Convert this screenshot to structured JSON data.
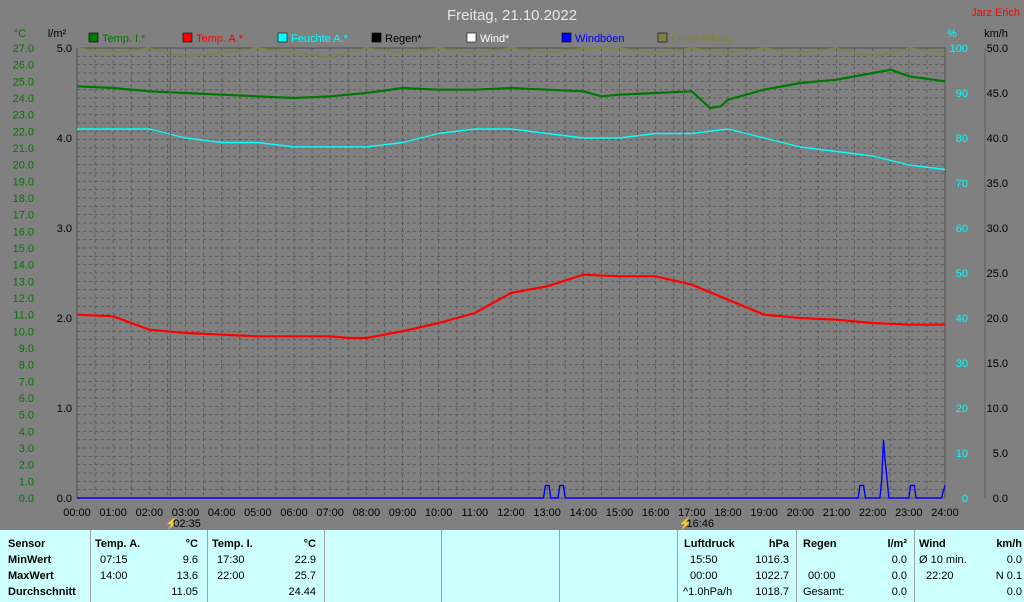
{
  "header": {
    "title": "Freitag, 21.10.2022",
    "author": "Jarz Erich"
  },
  "axis_units": {
    "left_temp": "°C",
    "left_rain": "l/m²",
    "right_humidity": "%",
    "right_wind": "km/h"
  },
  "legend": [
    {
      "label": "Temp. I.*",
      "color": "#007700"
    },
    {
      "label": "Temp. A.*",
      "color": "#ff0000"
    },
    {
      "label": "Feuchte A.*",
      "color": "#00ffff"
    },
    {
      "label": "Regen*",
      "color": "#000000"
    },
    {
      "label": "Wind*",
      "color": "#ffffff"
    },
    {
      "label": "Windböen",
      "color": "#0000ff"
    },
    {
      "label": "Einstrahlung",
      "color": "#808040"
    }
  ],
  "events": [
    {
      "time": "02:35",
      "hour": 2.58
    },
    {
      "time": "16:46",
      "hour": 16.77
    }
  ],
  "chart_data": {
    "type": "line",
    "title": "Freitag, 21.10.2022",
    "xlim": [
      0,
      24
    ],
    "x_ticks": [
      "00:00",
      "01:00",
      "02:00",
      "03:00",
      "04:00",
      "05:00",
      "06:00",
      "07:00",
      "08:00",
      "09:00",
      "10:00",
      "11:00",
      "12:00",
      "13:00",
      "14:00",
      "15:00",
      "16:00",
      "17:00",
      "18:00",
      "19:00",
      "20:00",
      "21:00",
      "22:00",
      "23:00",
      "24:00"
    ],
    "y_temp": {
      "min": 0,
      "max": 27,
      "ticks": [
        "0.0",
        "0.5",
        "1.0",
        "1.5",
        "2.0",
        "2.5",
        "3.0",
        "3.5",
        "4.0",
        "4.5",
        "5.0",
        "5.5",
        "6.0",
        "6.5",
        "7.0",
        "7.5",
        "8.0",
        "8.5",
        "9.0",
        "9.5",
        "10.0",
        "10.5",
        "11.0",
        "11.5",
        "12.0",
        "12.5",
        "13.0",
        "13.5",
        "14.0",
        "14.5",
        "15.0",
        "15.5",
        "16.0",
        "16.5",
        "17.0",
        "17.5",
        "18.0",
        "18.5",
        "19.0",
        "19.5",
        "20.0",
        "20.5",
        "21.0",
        "21.5",
        "22.0",
        "22.5",
        "23.0",
        "23.5",
        "24.0",
        "24.5",
        "25.0",
        "25.5",
        "26.0",
        "26.5",
        "27.0"
      ]
    },
    "y_rain": {
      "min": 0,
      "max": 5,
      "ticks": [
        "0.0",
        "1.0",
        "2.0",
        "3.0",
        "4.0",
        "5.0"
      ]
    },
    "y_humidity": {
      "min": 0,
      "max": 100,
      "ticks": [
        "0",
        "10",
        "20",
        "30",
        "40",
        "50",
        "60",
        "70",
        "80",
        "90",
        "100"
      ]
    },
    "y_wind": {
      "min": 0,
      "max": 50,
      "ticks": [
        "0.0",
        "5.0",
        "10.0",
        "15.0",
        "20.0",
        "25.0",
        "30.0",
        "35.0",
        "40.0",
        "45.0",
        "50.0"
      ]
    },
    "series": [
      {
        "name": "Temp. I.*",
        "axis": "temp",
        "color": "#007700",
        "x": [
          0,
          1,
          2,
          3,
          4,
          5,
          6,
          7,
          8,
          9,
          10,
          11,
          12,
          13,
          14,
          14.5,
          15,
          16,
          17,
          17.5,
          17.8,
          18,
          19,
          20,
          21,
          22,
          22.5,
          23,
          24
        ],
        "y": [
          24.7,
          24.6,
          24.4,
          24.3,
          24.2,
          24.1,
          24.0,
          24.1,
          24.3,
          24.6,
          24.5,
          24.5,
          24.6,
          24.5,
          24.4,
          24.1,
          24.2,
          24.3,
          24.4,
          23.4,
          23.5,
          23.9,
          24.5,
          24.9,
          25.1,
          25.5,
          25.7,
          25.3,
          25.0
        ]
      },
      {
        "name": "Temp. A.*",
        "axis": "temp",
        "color": "#ff0000",
        "x": [
          0,
          1,
          2,
          3,
          4,
          5,
          6,
          7,
          7.5,
          8,
          9,
          10,
          11,
          12,
          13,
          14,
          15,
          16,
          17,
          18,
          19,
          20,
          21,
          22,
          23,
          24
        ],
        "y": [
          11.0,
          10.9,
          10.1,
          9.9,
          9.8,
          9.7,
          9.7,
          9.7,
          9.6,
          9.6,
          10.0,
          10.5,
          11.1,
          12.3,
          12.7,
          13.4,
          13.3,
          13.3,
          12.8,
          11.9,
          11.0,
          10.8,
          10.7,
          10.5,
          10.4,
          10.4
        ]
      },
      {
        "name": "Feuchte A.*",
        "axis": "humidity",
        "color": "#00ffff",
        "x": [
          0,
          1,
          2,
          3,
          4,
          5,
          6,
          7,
          8,
          9,
          10,
          11,
          12,
          13,
          14,
          15,
          16,
          17,
          18,
          19,
          20,
          21,
          22,
          23,
          24
        ],
        "y": [
          82,
          82,
          82,
          80,
          79,
          79,
          78,
          78,
          78,
          79,
          81,
          82,
          82,
          81,
          80,
          80,
          81,
          81,
          82,
          80,
          78,
          77,
          76,
          74,
          73
        ]
      },
      {
        "name": "Windböen",
        "axis": "wind",
        "color": "#0000ff",
        "x": [
          0,
          12.9,
          12.95,
          13.05,
          13.1,
          13.3,
          13.35,
          13.45,
          13.5,
          21.6,
          21.65,
          21.75,
          21.8,
          22.2,
          22.25,
          22.3,
          22.35,
          22.4,
          22.45,
          23.0,
          23.05,
          23.15,
          23.2,
          23.9,
          24
        ],
        "y": [
          0,
          0,
          1.4,
          1.4,
          0,
          0,
          1.4,
          1.4,
          0,
          0,
          1.4,
          1.4,
          0,
          0,
          2.0,
          6.4,
          4.0,
          2.0,
          0,
          0,
          1.4,
          1.4,
          0,
          0,
          1.4
        ]
      },
      {
        "name": "Einstrahlung",
        "axis": "humidity",
        "color": "#808040",
        "x": [
          0,
          1,
          2,
          3,
          4,
          5,
          6,
          7,
          8,
          9,
          10,
          11,
          12,
          13,
          14,
          15,
          16,
          17,
          18,
          19,
          20,
          21,
          22,
          23,
          24
        ],
        "y": [
          100,
          99,
          100,
          98,
          99,
          100,
          99,
          98,
          100,
          99,
          100,
          99,
          100,
          99,
          100,
          100,
          99,
          100,
          99,
          100,
          99,
          100,
          98,
          100,
          99
        ]
      }
    ]
  },
  "table": {
    "sensor_label": "Sensor",
    "row_labels": [
      "MinWert",
      "MaxWert",
      "Durchschnitt"
    ],
    "temp_a": {
      "header": "Temp. A.",
      "unit": "°C",
      "min_time": "07:15",
      "min": "9.6",
      "max_time": "14:00",
      "max": "13.6",
      "avg": "11.05"
    },
    "temp_i": {
      "header": "Temp. I.",
      "unit": "°C",
      "min_time": "17:30",
      "min": "22.9",
      "max_time": "22:00",
      "max": "25.7",
      "avg": "24.44"
    },
    "pressure": {
      "header": "Luftdruck",
      "unit": "hPa",
      "r1_time": "15:50",
      "r1_val": "1016.3",
      "r2_time": "00:00",
      "r2_val": "1022.7",
      "r3_time": "^1.0hPa/h",
      "r3_val": "1018.7"
    },
    "rain": {
      "header": "Regen",
      "unit": "l/m²",
      "r1_val": "0.0",
      "r2_time": "00:00",
      "r2_val": "0.0",
      "r3_time": "Gesamt:",
      "r3_val": "0.0"
    },
    "wind": {
      "header": "Wind",
      "unit": "km/h",
      "r1_time": "Ø 10 min.",
      "r1_val": "0.0",
      "r2_time": "22:20",
      "r2_val": "N 0.1",
      "r3_val": "0.0"
    }
  }
}
